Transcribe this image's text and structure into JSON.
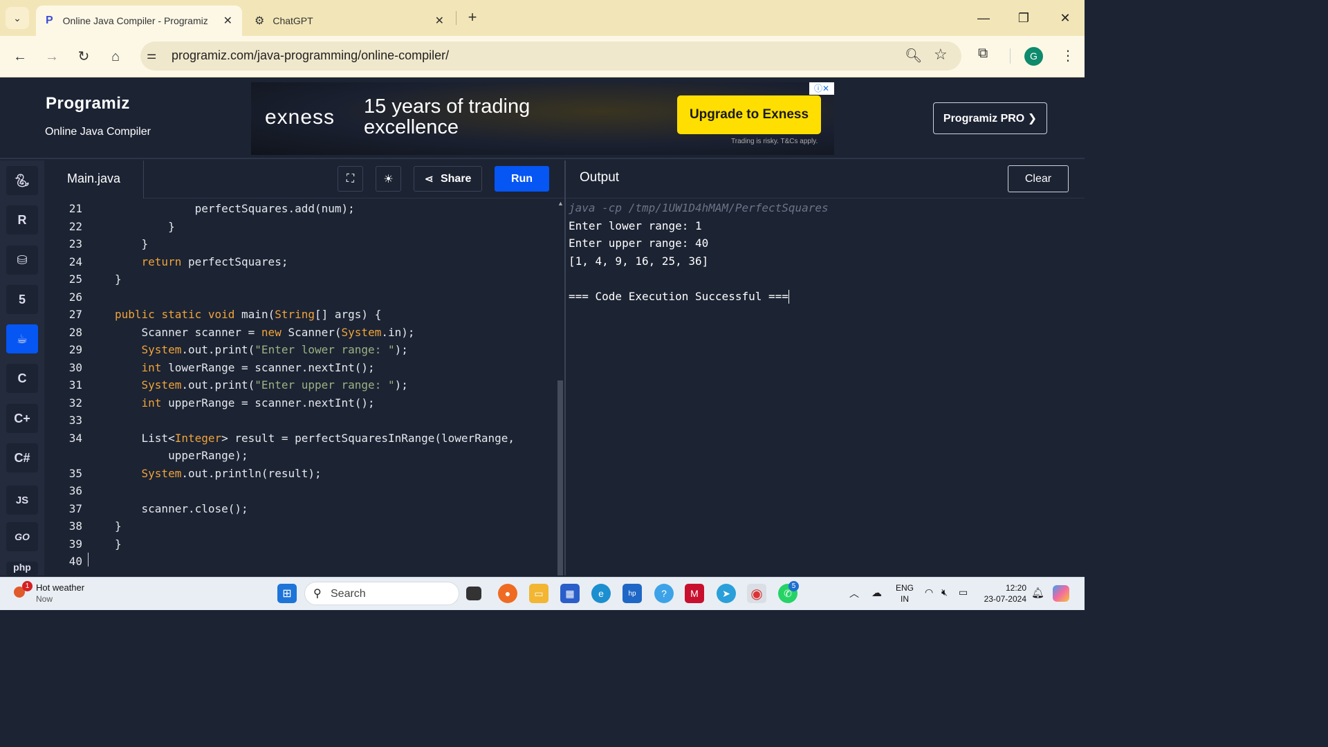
{
  "browser": {
    "tabs": [
      {
        "title": "Online Java Compiler - Programiz",
        "active": true
      },
      {
        "title": "ChatGPT",
        "active": false
      }
    ],
    "url": "programiz.com/java-programming/online-compiler/",
    "profile_initial": "G"
  },
  "site": {
    "logo": "Programiz",
    "subtitle": "Online Java Compiler",
    "pro_button": "Programiz PRO ❯"
  },
  "ad": {
    "brand": "exness",
    "headline": "15 years of trading excellence",
    "cta": "Upgrade to Exness",
    "disclaimer": "Trading is risky. T&Cs apply."
  },
  "languages": [
    "python-icon",
    "r-icon",
    "sql-icon",
    "html5-icon",
    "java-icon",
    "c-icon",
    "cpp-icon",
    "csharp-icon",
    "JS",
    "GO",
    "php"
  ],
  "editor": {
    "file_name": "Main.java",
    "share_label": "Share",
    "run_label": "Run",
    "lines": [
      {
        "n": "21",
        "text": "            perfectSquares.add(num);"
      },
      {
        "n": "22",
        "text": "        }"
      },
      {
        "n": "23",
        "text": "    }"
      },
      {
        "n": "24",
        "text": "    return perfectSquares;"
      },
      {
        "n": "25",
        "text": "}"
      },
      {
        "n": "26",
        "text": ""
      },
      {
        "n": "27",
        "text": "public static void main(String[] args) {"
      },
      {
        "n": "28",
        "text": "    Scanner scanner = new Scanner(System.in);"
      },
      {
        "n": "29",
        "text": "    System.out.print(\"Enter lower range: \");"
      },
      {
        "n": "30",
        "text": "    int lowerRange = scanner.nextInt();"
      },
      {
        "n": "31",
        "text": "    System.out.print(\"Enter upper range: \");"
      },
      {
        "n": "32",
        "text": "    int upperRange = scanner.nextInt();"
      },
      {
        "n": "33",
        "text": ""
      },
      {
        "n": "34",
        "text": "    List<Integer> result = perfectSquaresInRange(lowerRange,"
      },
      {
        "n": "",
        "text": "        upperRange);"
      },
      {
        "n": "35",
        "text": "    System.out.println(result);"
      },
      {
        "n": "36",
        "text": ""
      },
      {
        "n": "37",
        "text": "    scanner.close();"
      },
      {
        "n": "38",
        "text": "}"
      },
      {
        "n": "39",
        "text": "}"
      },
      {
        "n": "40",
        "text": ""
      }
    ]
  },
  "output": {
    "title": "Output",
    "clear_label": "Clear",
    "command": "java -cp /tmp/1UW1D4hMAM/PerfectSquares",
    "lines": [
      "Enter lower range: 1",
      "Enter upper range: 40",
      "[1, 4, 9, 16, 25, 36]",
      "",
      "=== Code Execution Successful ==="
    ]
  },
  "taskbar": {
    "weather_title": "Hot weather",
    "weather_sub": "Now",
    "weather_badge": "1",
    "search_placeholder": "Search",
    "lang_top": "ENG",
    "lang_bottom": "IN",
    "time": "12:20",
    "date": "23-07-2024",
    "whatsapp_badge": "5"
  }
}
